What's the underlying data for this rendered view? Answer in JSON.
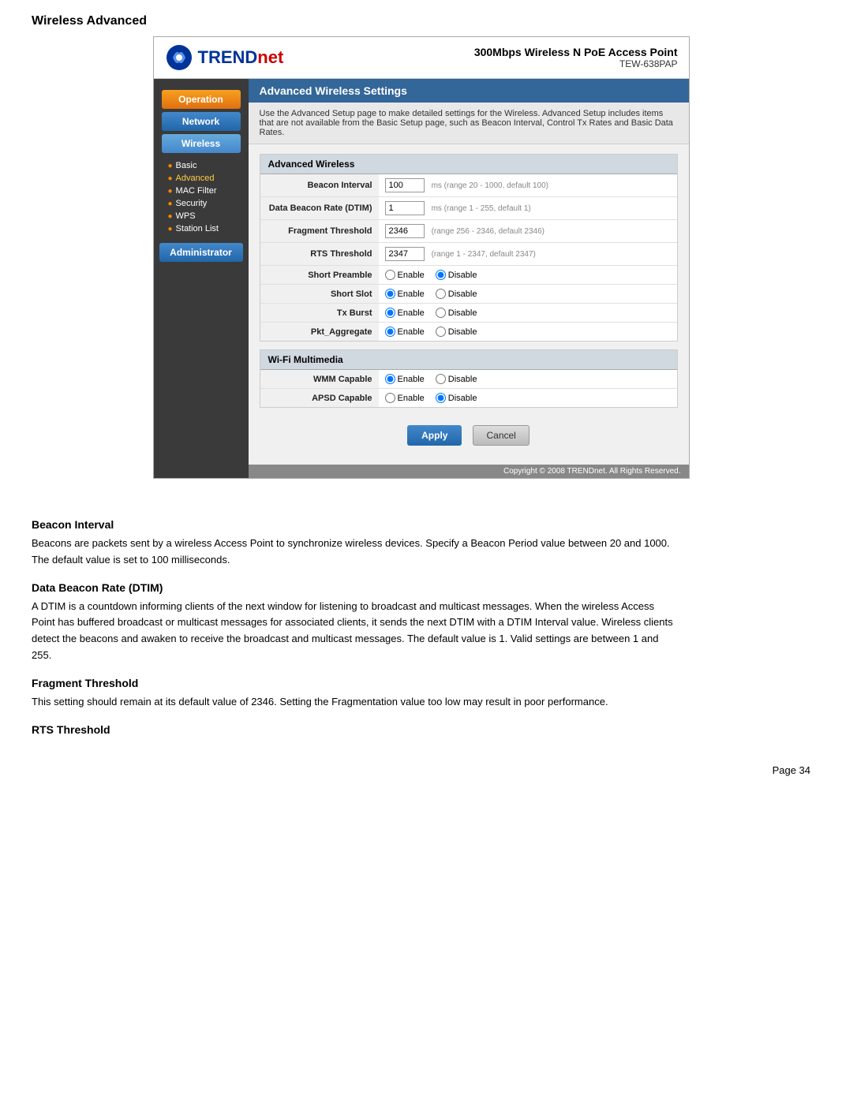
{
  "page": {
    "title": "Wireless Advanced"
  },
  "router": {
    "logo_text": "TRENDnet",
    "product_name": "300Mbps Wireless N PoE Access Point",
    "product_model": "TEW-638PAP",
    "header_title": "Advanced Wireless Settings",
    "description": "Use the Advanced Setup page to make detailed settings for the Wireless. Advanced Setup includes items that are not available from the Basic Setup page, such as Beacon Interval, Control Tx Rates and Basic Data Rates.",
    "copyright": "Copyright © 2008 TRENDnet. All Rights Reserved."
  },
  "sidebar": {
    "operation_label": "Operation",
    "network_label": "Network",
    "wireless_label": "Wireless",
    "admin_label": "Administrator",
    "sub_items": [
      {
        "label": "Basic",
        "active": false
      },
      {
        "label": "Advanced",
        "active": true
      },
      {
        "label": "MAC Filter",
        "active": false
      },
      {
        "label": "Security",
        "active": false
      },
      {
        "label": "WPS",
        "active": false
      },
      {
        "label": "Station List",
        "active": false
      }
    ]
  },
  "advanced_wireless": {
    "section_title": "Advanced Wireless",
    "fields": [
      {
        "label": "Beacon Interval",
        "value": "100",
        "hint": "ms (range 20 - 1000, default 100)",
        "type": "text"
      },
      {
        "label": "Data Beacon Rate (DTIM)",
        "value": "1",
        "hint": "ms (range 1 - 255, default 1)",
        "type": "text"
      },
      {
        "label": "Fragment Threshold",
        "value": "2346",
        "hint": "(range 256 - 2346, default 2346)",
        "type": "text"
      },
      {
        "label": "RTS Threshold",
        "value": "2347",
        "hint": "(range 1 - 2347, default 2347)",
        "type": "text"
      },
      {
        "label": "Short Preamble",
        "type": "radio",
        "selected": "disable"
      },
      {
        "label": "Short Slot",
        "type": "radio",
        "selected": "enable"
      },
      {
        "label": "Tx Burst",
        "type": "radio",
        "selected": "enable"
      },
      {
        "label": "Pkt_Aggregate",
        "type": "radio",
        "selected": "enable"
      }
    ]
  },
  "wifi_multimedia": {
    "section_title": "Wi-Fi Multimedia",
    "fields": [
      {
        "label": "WMM Capable",
        "type": "radio",
        "selected": "enable"
      },
      {
        "label": "APSD Capable",
        "type": "radio",
        "selected": "disable"
      }
    ]
  },
  "buttons": {
    "apply": "Apply",
    "cancel": "Cancel"
  },
  "text_sections": [
    {
      "heading": "Beacon Interval",
      "body": "Beacons are packets sent by a wireless Access Point to synchronize wireless devices. Specify a Beacon Period value between 20 and 1000. The default value is set to 100 milliseconds."
    },
    {
      "heading": "Data Beacon Rate (DTIM)",
      "body": "A DTIM is a countdown informing clients of the next window for listening to broadcast and multicast messages. When the wireless Access Point has buffered broadcast or multicast messages for associated clients, it sends the next DTIM with a DTIM Interval value. Wireless clients detect the beacons and awaken to receive the broadcast and multicast messages. The default value is 1. Valid settings are between 1 and 255."
    },
    {
      "heading": "Fragment Threshold",
      "body": "This setting should remain at its default value of 2346. Setting the Fragmentation value too low may result in poor performance."
    },
    {
      "heading": "RTS Threshold",
      "body": ""
    }
  ],
  "page_number": "Page  34"
}
